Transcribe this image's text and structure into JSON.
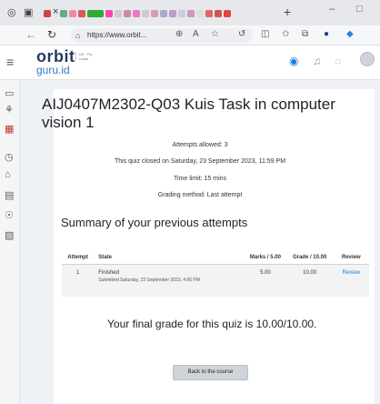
{
  "browser": {
    "tab_close": "×",
    "new_tab": "+",
    "window_minimize": "–",
    "window_maximize": "□",
    "url": "https://www.orbit...",
    "accent": "#1c7ed6"
  },
  "site": {
    "logo_line1": "orbit",
    "logo_line2": "guru.id",
    "logo_tagline": "Lift · Fly · Learn"
  },
  "quiz": {
    "title": "AIJ0407M2302-Q03 Kuis Task in computer vision 1",
    "attempts_allowed": "Attempts allowed: 3",
    "closed_notice": "This quiz closed on Saturday, 23 September 2023, 11:59 PM",
    "time_limit": "Time limit: 15 mins",
    "grading_method": "Grading method: Last attempt"
  },
  "summary": {
    "heading": "Summary of your previous attempts",
    "columns": [
      "Attempt",
      "State",
      "Marks / 5.00",
      "Grade / 10.00",
      "Review"
    ],
    "rows": [
      {
        "attempt": "1",
        "state": "Finished",
        "submitted": "Submitted Saturday, 23 September 2023, 4:06 PM",
        "marks": "5.00",
        "grade": "10.00",
        "review": "Review"
      }
    ]
  },
  "final_grade": "Your final grade for this quiz is 10.00/10.00.",
  "back_button": "Back to the course"
}
